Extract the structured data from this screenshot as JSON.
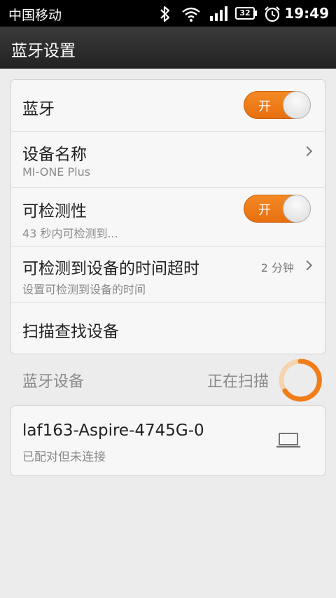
{
  "status_bar": {
    "carrier": "中国移动",
    "battery": "32",
    "time": "19:49"
  },
  "header": {
    "title": "蓝牙设置"
  },
  "settings": {
    "bluetooth": {
      "label": "蓝牙",
      "toggle_label": "开",
      "on": true
    },
    "device_name": {
      "label": "设备名称",
      "value": "MI-ONE Plus"
    },
    "discoverable": {
      "label": "可检测性",
      "toggle_label": "开",
      "on": true,
      "subtitle": "43 秒内可检测到..."
    },
    "timeout": {
      "label": "可检测到设备的时间超时",
      "value": "2 分钟",
      "subtitle": "设置可检测到设备的时间"
    },
    "scan": {
      "label": "扫描查找设备"
    }
  },
  "devices_section": {
    "title": "蓝牙设备",
    "status": "正在扫描"
  },
  "devices": [
    {
      "name": "laf163-Aspire-4745G-0",
      "status": "已配对但未连接",
      "icon": "laptop-icon"
    }
  ],
  "colors": {
    "accent": "#f07d1a",
    "background": "#ececec",
    "card": "#f7f7f7"
  }
}
